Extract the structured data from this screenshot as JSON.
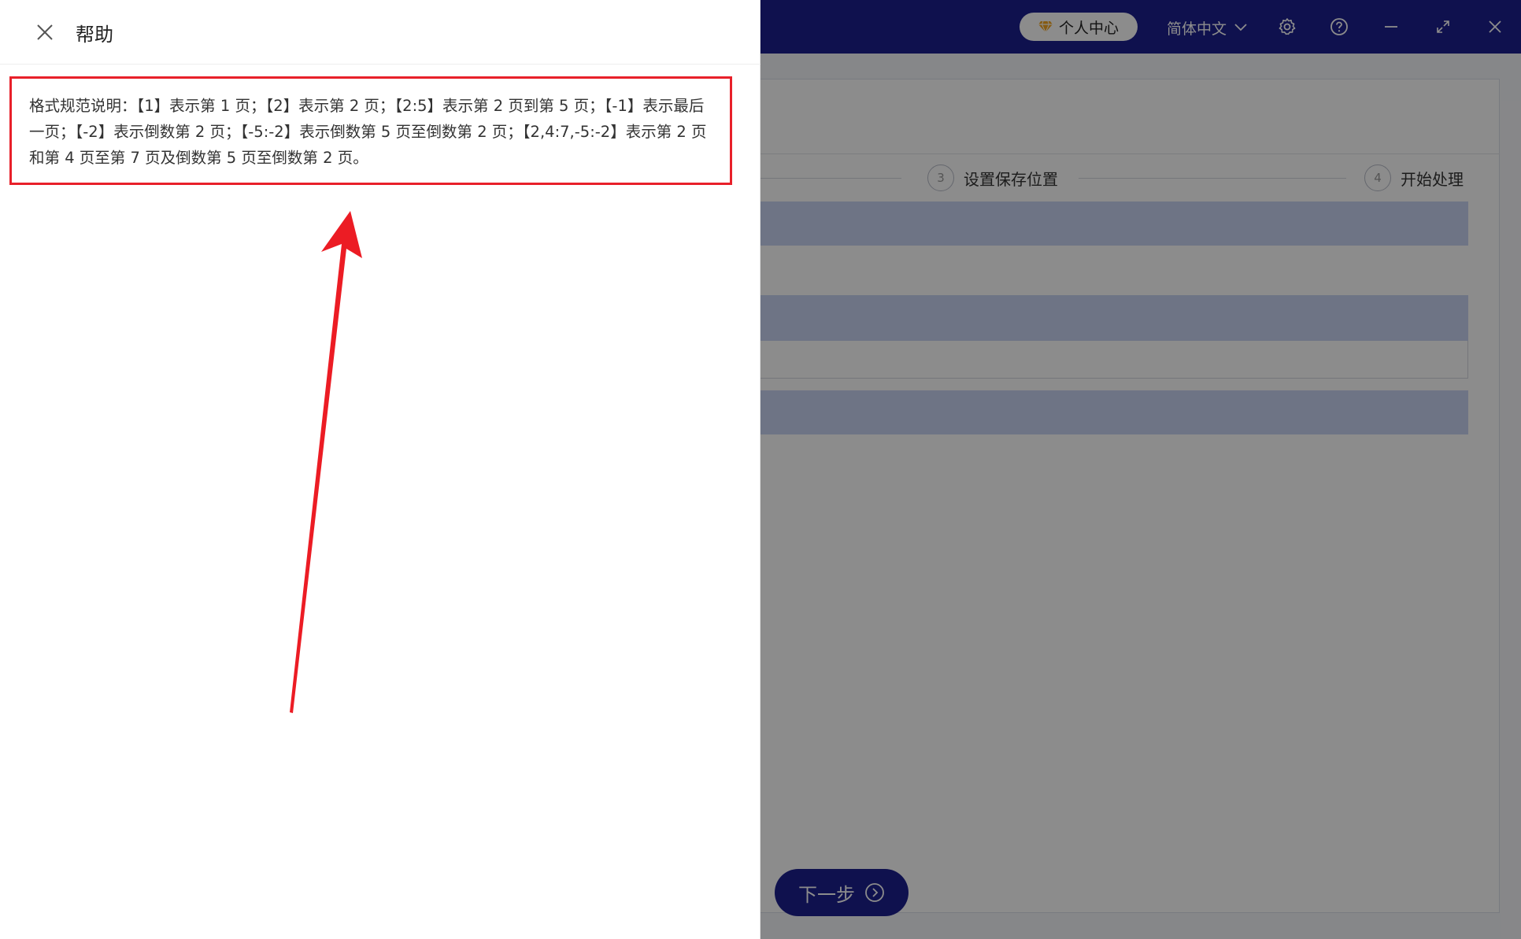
{
  "titlebar": {
    "user_center_label": "个人中心",
    "language_label": "简体中文",
    "icons": [
      "diamond-icon",
      "chevron-down-icon",
      "gear-icon",
      "help-circle-icon",
      "minimize-icon",
      "maximize-icon",
      "close-icon"
    ]
  },
  "steps": [
    {
      "number": "3",
      "label": "设置保存位置"
    },
    {
      "number": "4",
      "label": "开始处理"
    }
  ],
  "next_button": {
    "label": "下一步"
  },
  "drawer": {
    "title": "帮助",
    "help_text": "格式规范说明：【1】表示第 1 页；【2】表示第 2 页；【2:5】表示第 2 页到第 5 页；【-1】表示最后一页；【-2】表示倒数第 2 页；【-5:-2】表示倒数第 5 页至倒数第 2 页；【2,4:7,-5:-2】表示第 2 页和第 4 页至第 7 页及倒数第 5 页至倒数第 2 页。"
  },
  "colors": {
    "titlebar": "#1c1f8f",
    "highlight_box": "#e8202a",
    "arrow": "#ec1c24",
    "overlay": "rgba(0,0,0,0.45)"
  }
}
